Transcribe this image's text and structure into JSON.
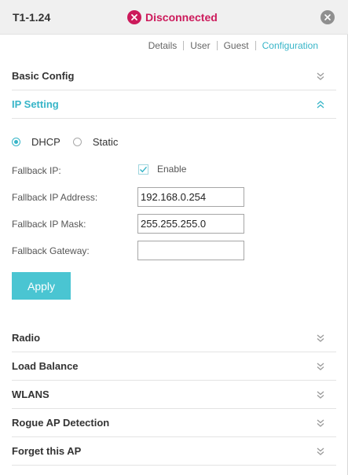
{
  "header": {
    "device_name": "T1-1.24",
    "status_text": "Disconnected",
    "status_icon": "x-circle-icon",
    "close_icon": "close-icon",
    "status_color": "#cc1a5b"
  },
  "tabs": [
    {
      "label": "Details",
      "active": false
    },
    {
      "label": "User",
      "active": false
    },
    {
      "label": "Guest",
      "active": false
    },
    {
      "label": "Configuration",
      "active": true
    }
  ],
  "sections": {
    "basic_config": {
      "label": "Basic Config",
      "expanded": false
    },
    "ip_setting": {
      "label": "IP Setting",
      "expanded": true
    },
    "radio": {
      "label": "Radio",
      "expanded": false
    },
    "load_balance": {
      "label": "Load Balance",
      "expanded": false
    },
    "wlans": {
      "label": "WLANS",
      "expanded": false
    },
    "rogue_ap": {
      "label": "Rogue AP Detection",
      "expanded": false
    },
    "forget_ap": {
      "label": "Forget this AP",
      "expanded": false
    }
  },
  "ip_setting": {
    "mode_options": [
      {
        "label": "DHCP",
        "selected": true
      },
      {
        "label": "Static",
        "selected": false
      }
    ],
    "fallback_ip_label": "Fallback IP:",
    "fallback_enable_label": "Enable",
    "fallback_enabled": true,
    "fallback_address_label": "Fallback IP Address:",
    "fallback_address_value": "192.168.0.254",
    "fallback_mask_label": "Fallback IP Mask:",
    "fallback_mask_value": "255.255.255.0",
    "fallback_gateway_label": "Fallback Gateway:",
    "fallback_gateway_value": "",
    "apply_label": "Apply"
  },
  "colors": {
    "accent": "#37b5c8",
    "button": "#4ac5d2",
    "error": "#cc1a5b"
  }
}
